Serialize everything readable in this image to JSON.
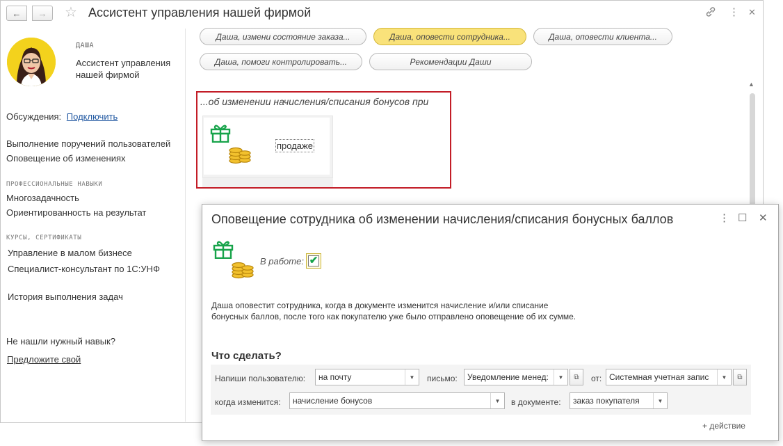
{
  "window": {
    "title": "Ассистент управления нашей фирмой",
    "back_icon": "←",
    "forward_icon": "→",
    "star_icon": "☆",
    "link_icon": "🔗",
    "menu_icon": "⋮",
    "close_icon": "✕"
  },
  "assistant": {
    "name_caption": "ДАША",
    "description": "Ассистент управления нашей фирмой"
  },
  "left_panel": {
    "discussions_label": "Обсуждения:",
    "discussions_link": "Подключить",
    "duties": [
      "Выполнение поручений пользователей",
      "Оповещение об изменениях"
    ],
    "skills_heading": "ПРОФЕССИОНАЛЬНЫЕ НАВЫКИ",
    "skills": [
      "Многозадачность",
      "Ориентированность на результат"
    ],
    "courses_heading": "КУРСЫ, СЕРТИФИКАТЫ",
    "courses": [
      "Управление в малом бизнесе",
      "Специалист-консультант по 1С:УНФ"
    ],
    "history": "История выполнения задач",
    "not_found": "Не нашли нужный навык?",
    "suggest_link": "Предложите свой"
  },
  "skill_buttons": [
    {
      "label": "Даша, измени состояние заказа...",
      "active": false
    },
    {
      "label": "Даша, оповести сотрудника...",
      "active": true
    },
    {
      "label": "Даша, оповести клиента...",
      "active": false
    },
    {
      "label": "Даша, помоги контролировать...",
      "active": false
    },
    {
      "label": "Рекомендации Даши",
      "active": false
    }
  ],
  "event": {
    "title": "...об изменении начисления/списания бонусов при",
    "card_label": "продаже"
  },
  "dialog": {
    "title": "Оповещение сотрудника об изменении начисления/списания бонусных баллов",
    "menu_icon": "⋮",
    "maximize_icon": "☐",
    "close_icon": "✕",
    "in_work_label": "В работе:",
    "in_work_checked": true,
    "check_mark": "✔",
    "description_line1": "Даша оповестит сотрудника, когда в документе изменится начисление и/или списание",
    "description_line2": "бонусных баллов, после того как покупателю уже было отправлено оповещение об их сумме.",
    "what_to_do": "Что сделать?",
    "row1": {
      "write_label": "Напиши пользователю:",
      "write_value": "на почту",
      "letter_label": "письмо:",
      "letter_value": "Уведомление менед:",
      "from_label": "от:",
      "from_value": "Системная учетная запис"
    },
    "row2": {
      "when_label": "когда изменится:",
      "when_value": "начисление бонусов",
      "doc_label": "в документе:",
      "doc_value": "заказ покупателя"
    },
    "dropdown_icon": "▼",
    "open_icon": "⧉",
    "add_action": "+ действие"
  },
  "colors": {
    "active_button": "#f9e27a",
    "highlight_border": "#c31d27",
    "link": "#1e56a0",
    "gift_icon": "#17a34a",
    "coins_icon": "#d9a514",
    "avatar_bg": "#f3d21d"
  },
  "icons": [
    "gift-icon",
    "coins-icon",
    "avatar-portrait"
  ]
}
